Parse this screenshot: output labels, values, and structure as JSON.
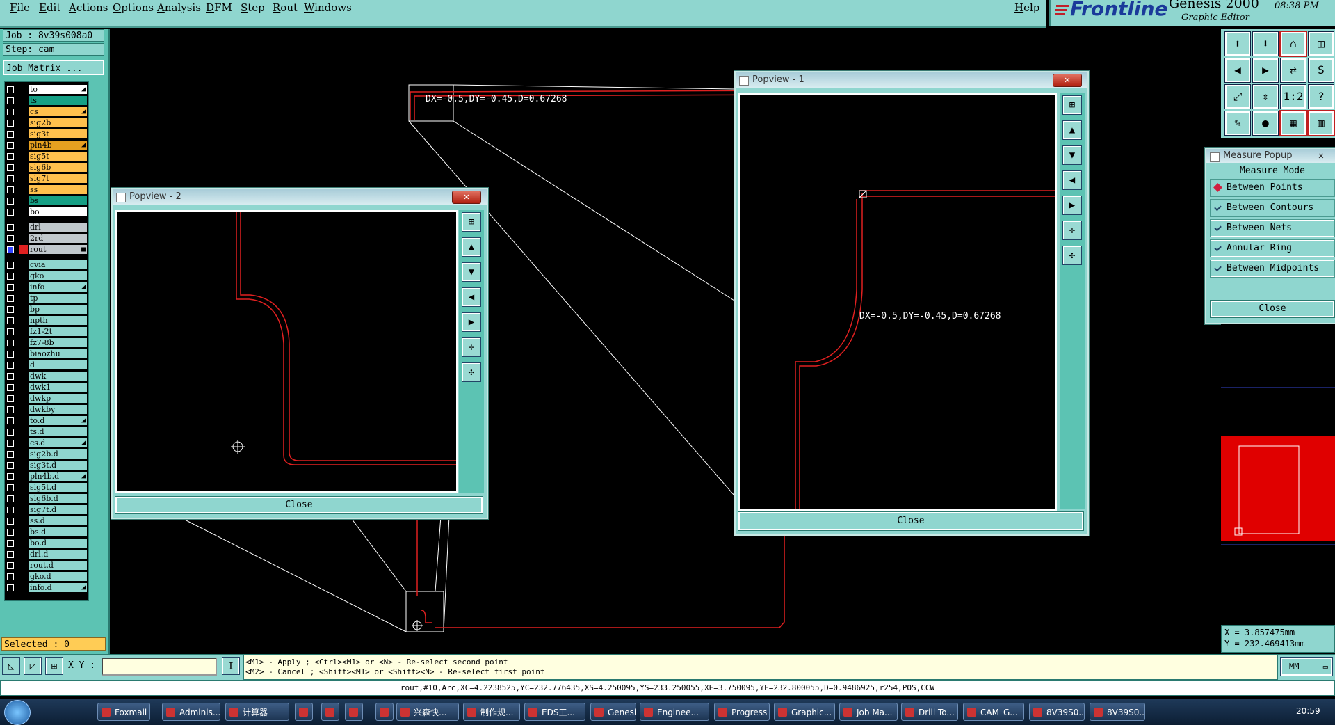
{
  "menu": [
    "File",
    "Edit",
    "Actions",
    "Options",
    "Analysis",
    "DFM",
    "Step",
    "Rout",
    "Windows"
  ],
  "help": "Help",
  "brand": {
    "logo": "Frontline",
    "product": "Genesis 2000",
    "subtitle": "Graphic Editor",
    "time": "08:38 PM"
  },
  "job": "Job : 8v39s008a0",
  "step": "Step: cam",
  "job_matrix": "Job Matrix ...",
  "layers": [
    {
      "name": "to",
      "color": "#ffffff",
      "flag": "◢"
    },
    {
      "name": "ts",
      "color": "#16a085",
      "flag": ""
    },
    {
      "name": "cs",
      "color": "#ffc04d",
      "flag": "◢"
    },
    {
      "name": "sig2b",
      "color": "#ffc04d",
      "flag": ""
    },
    {
      "name": "sig3t",
      "color": "#ffc04d",
      "flag": ""
    },
    {
      "name": "pln4b",
      "color": "#e6a020",
      "flag": "◢"
    },
    {
      "name": "sig5t",
      "color": "#ffc04d",
      "flag": ""
    },
    {
      "name": "sig6b",
      "color": "#ffc04d",
      "flag": ""
    },
    {
      "name": "sig7t",
      "color": "#ffc04d",
      "flag": ""
    },
    {
      "name": "ss",
      "color": "#ffc04d",
      "flag": ""
    },
    {
      "name": "bs",
      "color": "#16a085",
      "flag": ""
    },
    {
      "name": "bo",
      "color": "#ffffff",
      "flag": ""
    },
    {
      "name": "drl",
      "color": "#c0c8cc",
      "flag": ""
    },
    {
      "name": "2rd",
      "color": "#c0c8cc",
      "flag": ""
    },
    {
      "name": "rout",
      "color": "#c0c8cc",
      "flag": "■",
      "active": true
    },
    {
      "name": "cvia",
      "color": "#8fd6cf",
      "flag": ""
    },
    {
      "name": "gko",
      "color": "#8fd6cf",
      "flag": ""
    },
    {
      "name": "info",
      "color": "#8fd6cf",
      "flag": "◢"
    },
    {
      "name": "tp",
      "color": "#8fd6cf",
      "flag": ""
    },
    {
      "name": "bp",
      "color": "#8fd6cf",
      "flag": ""
    },
    {
      "name": "npth",
      "color": "#8fd6cf",
      "flag": ""
    },
    {
      "name": "fz1-2t",
      "color": "#8fd6cf",
      "flag": ""
    },
    {
      "name": "fz7-8b",
      "color": "#8fd6cf",
      "flag": ""
    },
    {
      "name": "biaozhu",
      "color": "#8fd6cf",
      "flag": ""
    },
    {
      "name": "d",
      "color": "#8fd6cf",
      "flag": ""
    },
    {
      "name": "dwk",
      "color": "#8fd6cf",
      "flag": ""
    },
    {
      "name": "dwk1",
      "color": "#8fd6cf",
      "flag": ""
    },
    {
      "name": "dwkp",
      "color": "#8fd6cf",
      "flag": ""
    },
    {
      "name": "dwkby",
      "color": "#8fd6cf",
      "flag": ""
    },
    {
      "name": "to.d",
      "color": "#8fd6cf",
      "flag": "◢"
    },
    {
      "name": "ts.d",
      "color": "#8fd6cf",
      "flag": ""
    },
    {
      "name": "cs.d",
      "color": "#8fd6cf",
      "flag": "◢"
    },
    {
      "name": "sig2b.d",
      "color": "#8fd6cf",
      "flag": ""
    },
    {
      "name": "sig3t.d",
      "color": "#8fd6cf",
      "flag": ""
    },
    {
      "name": "pln4b.d",
      "color": "#8fd6cf",
      "flag": "◢"
    },
    {
      "name": "sig5t.d",
      "color": "#8fd6cf",
      "flag": ""
    },
    {
      "name": "sig6b.d",
      "color": "#8fd6cf",
      "flag": ""
    },
    {
      "name": "sig7t.d",
      "color": "#8fd6cf",
      "flag": ""
    },
    {
      "name": "ss.d",
      "color": "#8fd6cf",
      "flag": ""
    },
    {
      "name": "bs.d",
      "color": "#8fd6cf",
      "flag": ""
    },
    {
      "name": "bo.d",
      "color": "#8fd6cf",
      "flag": ""
    },
    {
      "name": "drl.d",
      "color": "#8fd6cf",
      "flag": ""
    },
    {
      "name": "rout.d",
      "color": "#8fd6cf",
      "flag": ""
    },
    {
      "name": "gko.d",
      "color": "#8fd6cf",
      "flag": ""
    },
    {
      "name": "info.d",
      "color": "#8fd6cf",
      "flag": "◢"
    }
  ],
  "selected": "Selected : 0",
  "xy_label": "X Y :",
  "xy_value": "",
  "hint1": "<M1> - Apply  ; <Ctrl><M1> or <N> - Re-select second point",
  "hint2": "<M2> - Cancel ; <Shift><M1> or <Shift><N> - Re-select first point",
  "units": "MM",
  "status": "rout,#10,Arc,XC=4.2238525,YC=232.776435,XS=4.250095,YS=233.250055,XE=3.750095,YE=232.800055,D=0.9486925,r254,POS,CCW",
  "measure_text": "DX=-0.5,DY=-0.45,D=0.67268",
  "popview1": {
    "title": "Popview - 1",
    "close": "Close",
    "measure": "DX=-0.5,DY=-0.45,D=0.67268"
  },
  "popview2": {
    "title": "Popview - 2",
    "close": "Close"
  },
  "measure_popup": {
    "title": "Measure Popup",
    "heading": "Measure Mode",
    "modes": [
      "Between Points",
      "Between Contours",
      "Between Nets",
      "Annular Ring",
      "Between Midpoints"
    ],
    "selected_mode": 0,
    "close": "Close"
  },
  "coords": {
    "x": "X = 3.857475mm",
    "y": "Y = 232.469413mm"
  },
  "taskbar": {
    "items": [
      "Foxmail",
      "Adminis...",
      "计算器",
      "",
      "",
      "",
      "",
      "兴森快...",
      "制作规...",
      "EDS工...",
      "Genesis",
      "Enginee...",
      "Progress",
      "Graphic...",
      "Job Ma...",
      "Drill To...",
      "CAM_G...",
      "8V39S0...",
      "8V39S0..."
    ],
    "clock": "20:59"
  },
  "colors": {
    "teal": "#8fd6cf",
    "teal_dark": "#5cc3b3",
    "rout_red": "#e02020"
  }
}
